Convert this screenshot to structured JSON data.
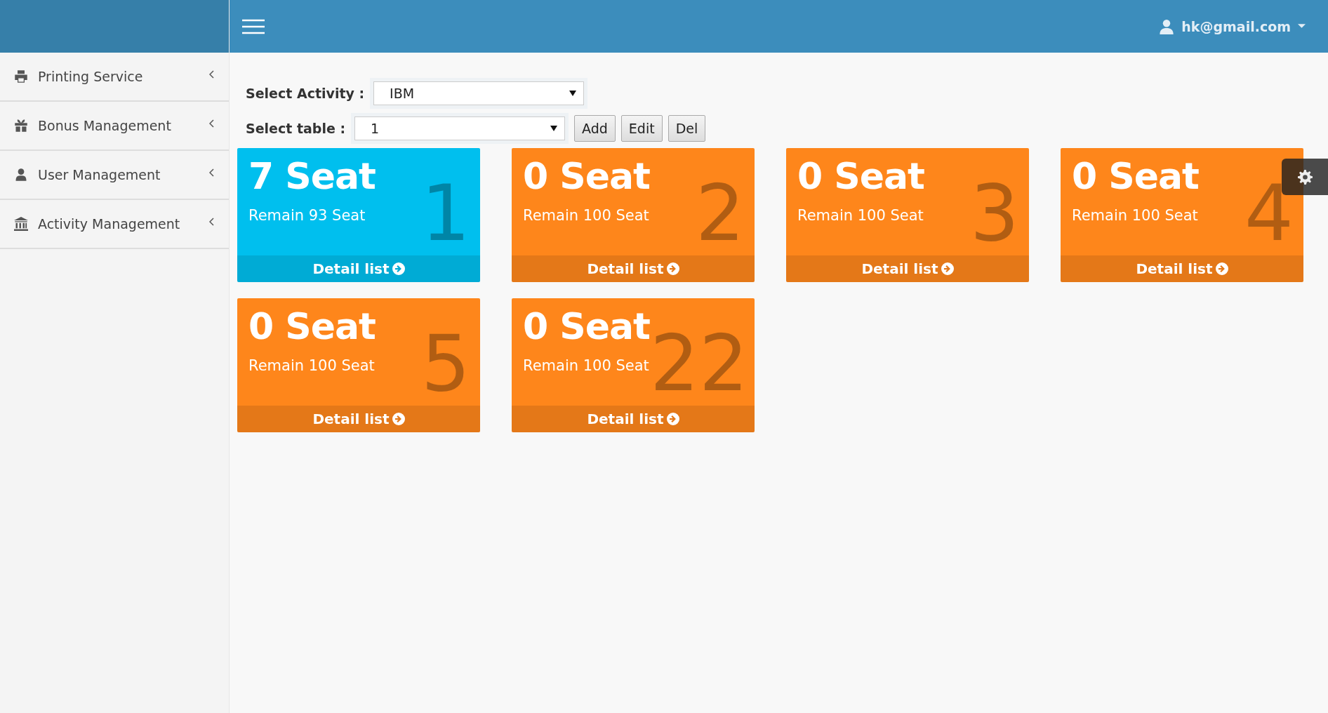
{
  "header": {
    "user": "hk@gmail.com"
  },
  "sidebar": {
    "items": [
      {
        "kind": "printer",
        "label": "Printing Service"
      },
      {
        "kind": "gift",
        "label": "Bonus Management"
      },
      {
        "kind": "user",
        "label": "User Management"
      },
      {
        "kind": "bank",
        "label": "Activity Management"
      }
    ]
  },
  "filters": {
    "activity_label": "Select Activity :",
    "activity_value": "IBM",
    "table_label": "Select table :",
    "table_value": "1",
    "buttons": [
      "Add",
      "Edit",
      "Del"
    ]
  },
  "tiles": [
    {
      "seats": "7 Seat",
      "remain": "Remain 93 Seat",
      "number": "1",
      "link": "Detail list",
      "color": "#00bfee"
    },
    {
      "seats": "0 Seat",
      "remain": "Remain 100 Seat",
      "number": "2",
      "link": "Detail list",
      "color": "#fe861b"
    },
    {
      "seats": "0 Seat",
      "remain": "Remain 100 Seat",
      "number": "3",
      "link": "Detail list",
      "color": "#fe861b"
    },
    {
      "seats": "0 Seat",
      "remain": "Remain 100 Seat",
      "number": "4",
      "link": "Detail list",
      "color": "#fe861b"
    },
    {
      "seats": "0 Seat",
      "remain": "Remain 100 Seat",
      "number": "5",
      "link": "Detail list",
      "color": "#fe861b"
    },
    {
      "seats": "0 Seat",
      "remain": "Remain 100 Seat",
      "number": "22",
      "link": "Detail list",
      "color": "#fe861b"
    }
  ]
}
